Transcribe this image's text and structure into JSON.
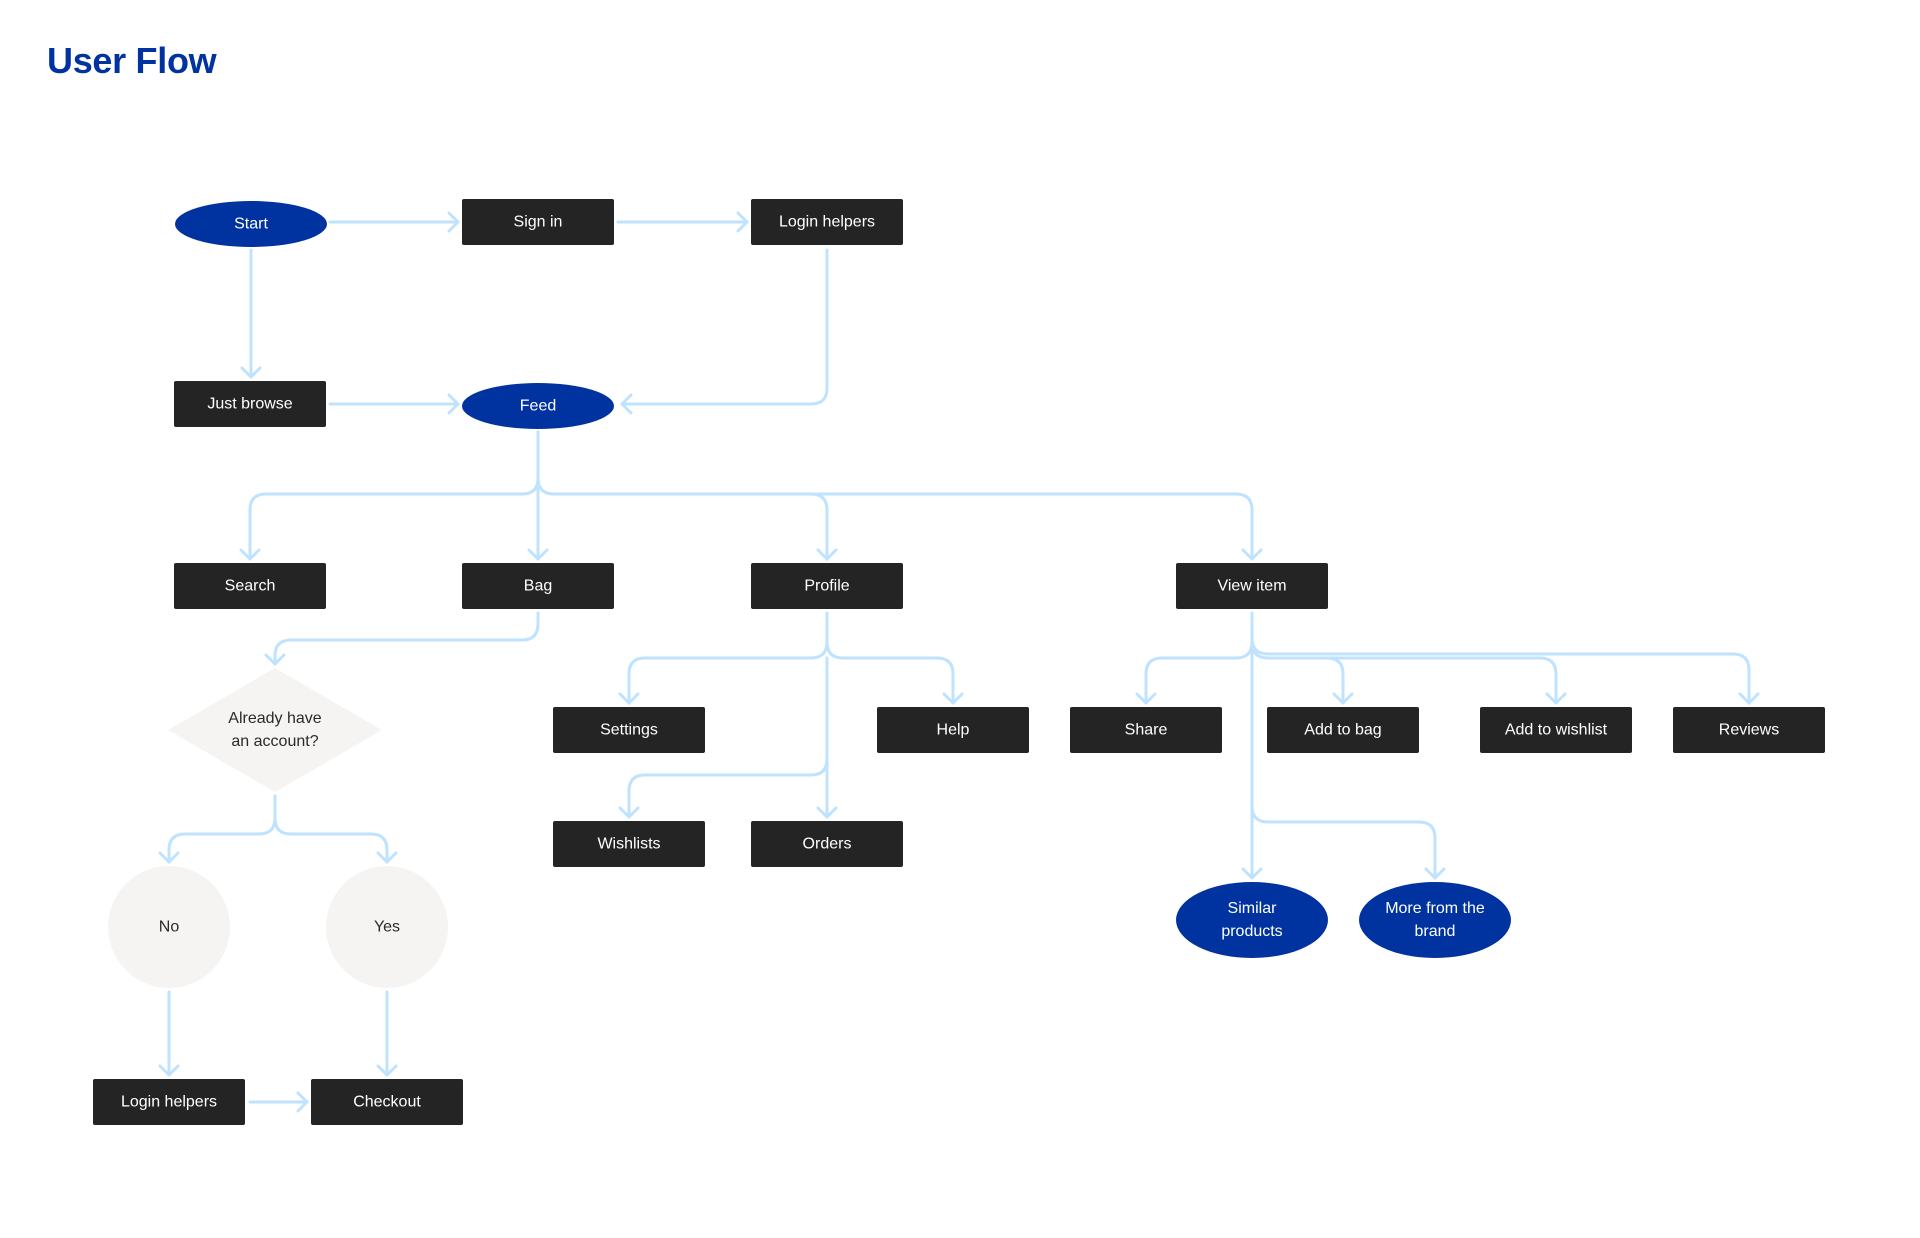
{
  "title": "User Flow",
  "colors": {
    "primary_blue": "#0033A0",
    "process_box": "#242424",
    "decision_fill": "#F5F4F2",
    "connector": "#BFE3FF"
  },
  "nodes": [
    {
      "id": "start",
      "label": [
        "Start"
      ],
      "shape": "ellipse"
    },
    {
      "id": "sign-in",
      "label": [
        "Sign in"
      ],
      "shape": "box"
    },
    {
      "id": "login-helpers-top",
      "label": [
        "Login helpers"
      ],
      "shape": "box"
    },
    {
      "id": "just-browse",
      "label": [
        "Just browse"
      ],
      "shape": "box"
    },
    {
      "id": "feed",
      "label": [
        "Feed"
      ],
      "shape": "ellipse"
    },
    {
      "id": "search",
      "label": [
        "Search"
      ],
      "shape": "box"
    },
    {
      "id": "bag",
      "label": [
        "Bag"
      ],
      "shape": "box"
    },
    {
      "id": "profile",
      "label": [
        "Profile"
      ],
      "shape": "box"
    },
    {
      "id": "view-item",
      "label": [
        "View item"
      ],
      "shape": "box"
    },
    {
      "id": "already-have-account",
      "label": [
        "Already have",
        "an account?"
      ],
      "shape": "diamond"
    },
    {
      "id": "settings",
      "label": [
        "Settings"
      ],
      "shape": "box"
    },
    {
      "id": "help",
      "label": [
        "Help"
      ],
      "shape": "box"
    },
    {
      "id": "wishlists",
      "label": [
        "Wishlists"
      ],
      "shape": "box"
    },
    {
      "id": "orders",
      "label": [
        "Orders"
      ],
      "shape": "box"
    },
    {
      "id": "share",
      "label": [
        "Share"
      ],
      "shape": "box"
    },
    {
      "id": "add-to-bag",
      "label": [
        "Add to bag"
      ],
      "shape": "box"
    },
    {
      "id": "add-to-wishlist",
      "label": [
        "Add to wishlist"
      ],
      "shape": "box"
    },
    {
      "id": "reviews",
      "label": [
        "Reviews"
      ],
      "shape": "box"
    },
    {
      "id": "similar-products",
      "label": [
        "Similar",
        "products"
      ],
      "shape": "ellipse"
    },
    {
      "id": "more-from-brand",
      "label": [
        "More from the",
        "brand"
      ],
      "shape": "ellipse"
    },
    {
      "id": "no",
      "label": [
        "No"
      ],
      "shape": "circle"
    },
    {
      "id": "yes",
      "label": [
        "Yes"
      ],
      "shape": "circle"
    },
    {
      "id": "login-helpers-bottom",
      "label": [
        "Login helpers"
      ],
      "shape": "box"
    },
    {
      "id": "checkout",
      "label": [
        "Checkout"
      ],
      "shape": "box"
    }
  ],
  "edges": [
    {
      "from": "start",
      "to": "sign-in"
    },
    {
      "from": "sign-in",
      "to": "login-helpers-top"
    },
    {
      "from": "start",
      "to": "just-browse"
    },
    {
      "from": "just-browse",
      "to": "feed"
    },
    {
      "from": "login-helpers-top",
      "to": "feed"
    },
    {
      "from": "feed",
      "to": "search"
    },
    {
      "from": "feed",
      "to": "bag"
    },
    {
      "from": "feed",
      "to": "profile"
    },
    {
      "from": "feed",
      "to": "view-item"
    },
    {
      "from": "bag",
      "to": "already-have-account"
    },
    {
      "from": "already-have-account",
      "to": "no"
    },
    {
      "from": "already-have-account",
      "to": "yes"
    },
    {
      "from": "no",
      "to": "login-helpers-bottom"
    },
    {
      "from": "yes",
      "to": "checkout"
    },
    {
      "from": "login-helpers-bottom",
      "to": "checkout"
    },
    {
      "from": "profile",
      "to": "settings"
    },
    {
      "from": "profile",
      "to": "help"
    },
    {
      "from": "profile",
      "to": "wishlists"
    },
    {
      "from": "profile",
      "to": "orders"
    },
    {
      "from": "view-item",
      "to": "share"
    },
    {
      "from": "view-item",
      "to": "add-to-bag"
    },
    {
      "from": "view-item",
      "to": "add-to-wishlist"
    },
    {
      "from": "view-item",
      "to": "reviews"
    },
    {
      "from": "view-item",
      "to": "similar-products"
    },
    {
      "from": "view-item",
      "to": "more-from-brand"
    }
  ]
}
